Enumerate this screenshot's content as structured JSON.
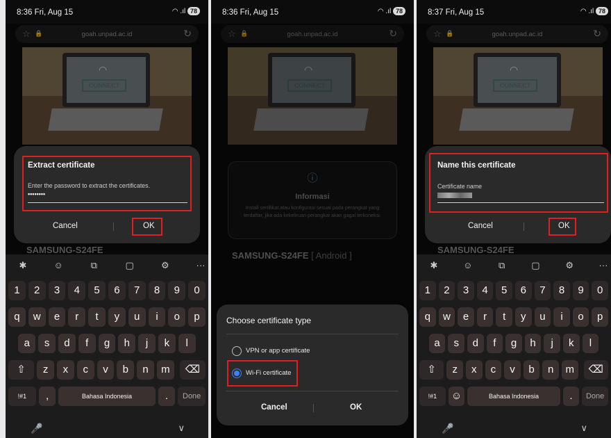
{
  "common": {
    "url": "goah.unpad.ac.id",
    "battery": "78",
    "connect_label": "CONNECT",
    "device_title": "SAMSUNG-S24FE",
    "device_os": "[ Android ]"
  },
  "panel1": {
    "time": "8:36  Fri, Aug 15",
    "dialog": {
      "title": "Extract certificate",
      "label": "Enter the password to extract the certificates.",
      "password_value": "••••••••",
      "cancel": "Cancel",
      "ok": "OK"
    }
  },
  "panel2": {
    "time": "8:36  Fri, Aug 15",
    "info": {
      "title": "Informasi",
      "body": "Install sertifikat atau konfigurasi sesuai pada perangkat yang terdaftar, jika ada kekeliruan perangkat akan gagal terkoneksi."
    },
    "sheet": {
      "title": "Choose certificate type",
      "options": [
        "VPN or app certificate",
        "Wi-Fi certificate"
      ],
      "selected": "Wi-Fi certificate",
      "cancel": "Cancel",
      "ok": "OK"
    }
  },
  "panel3": {
    "time": "8:37  Fri, Aug 15",
    "dialog": {
      "title": "Name this certificate",
      "label": "Certificate name",
      "cancel": "Cancel",
      "ok": "OK"
    }
  },
  "keyboard": {
    "numbers": [
      "1",
      "2",
      "3",
      "4",
      "5",
      "6",
      "7",
      "8",
      "9",
      "0"
    ],
    "row1": [
      "q",
      "w",
      "e",
      "r",
      "t",
      "y",
      "u",
      "i",
      "o",
      "p"
    ],
    "row2": [
      "a",
      "s",
      "d",
      "f",
      "g",
      "h",
      "j",
      "k",
      "l"
    ],
    "row3": [
      "z",
      "x",
      "c",
      "v",
      "b",
      "n",
      "m"
    ],
    "symbols": "!#1",
    "comma": ",",
    "space": "Bahasa Indonesia",
    "period": ".",
    "done": "Done"
  },
  "colors": {
    "highlight": "#e02020",
    "accent": "#3a82f7"
  }
}
